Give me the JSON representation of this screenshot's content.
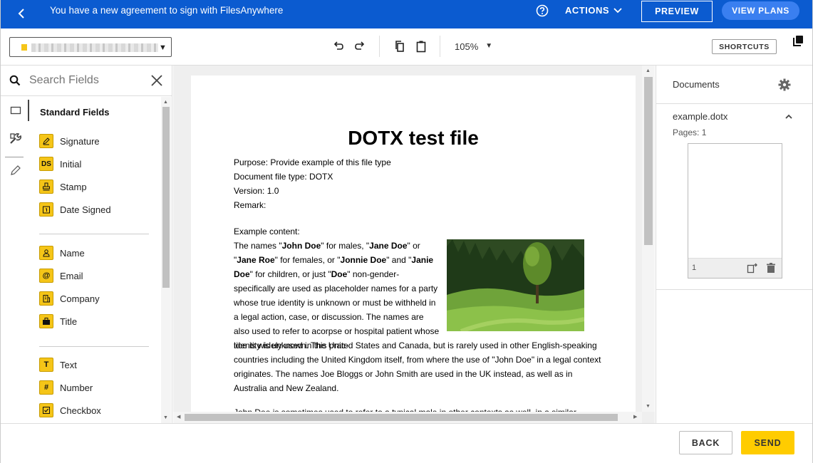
{
  "banner": {
    "message": "You have a new agreement to sign with FilesAnywhere",
    "actions_label": "ACTIONS",
    "preview_label": "PREVIEW",
    "plans_label": "VIEW PLANS",
    "bg_color": "#0b5bd0"
  },
  "toolbar": {
    "zoom": "105%",
    "shortcuts_label": "SHORTCUTS"
  },
  "search": {
    "placeholder": "Search Fields"
  },
  "fields": {
    "heading": "Standard Fields",
    "group1": [
      {
        "label": "Signature",
        "icon": "pen-icon"
      },
      {
        "label": "Initial",
        "icon": "initials-icon"
      },
      {
        "label": "Stamp",
        "icon": "stamp-icon"
      },
      {
        "label": "Date Signed",
        "icon": "calendar-icon"
      }
    ],
    "group2": [
      {
        "label": "Name",
        "icon": "person-icon"
      },
      {
        "label": "Email",
        "icon": "at-icon"
      },
      {
        "label": "Company",
        "icon": "building-icon"
      },
      {
        "label": "Title",
        "icon": "briefcase-icon"
      }
    ],
    "group3": [
      {
        "label": "Text",
        "icon": "text-icon"
      },
      {
        "label": "Number",
        "icon": "hash-icon"
      },
      {
        "label": "Checkbox",
        "icon": "checkbox-icon"
      }
    ]
  },
  "document": {
    "title": "DOTX test file",
    "meta": [
      "Purpose: Provide example of this file type",
      "Document file type: DOTX",
      "Version: 1.0",
      "Remark:"
    ],
    "example_label": "Example content:",
    "para2": "tice is widely used in the United States and Canada, but is rarely used in other English-speaking countries including the United Kingdom itself, from where the use of \"John Doe\" in a legal context originates. The names Joe Bloggs or John Smith are used in the UK instead, as well as in Australia and New Zealand.",
    "para3": "John Doe is sometimes used to refer to a typical male in other contexts as well, in a similar manner"
  },
  "right_panel": {
    "title": "Documents",
    "doc_name": "example.dotx",
    "pages": "Pages: 1",
    "thumb_page": "1"
  },
  "footer": {
    "back_label": "BACK",
    "send_label": "SEND",
    "send_color": "#ffcc00"
  }
}
